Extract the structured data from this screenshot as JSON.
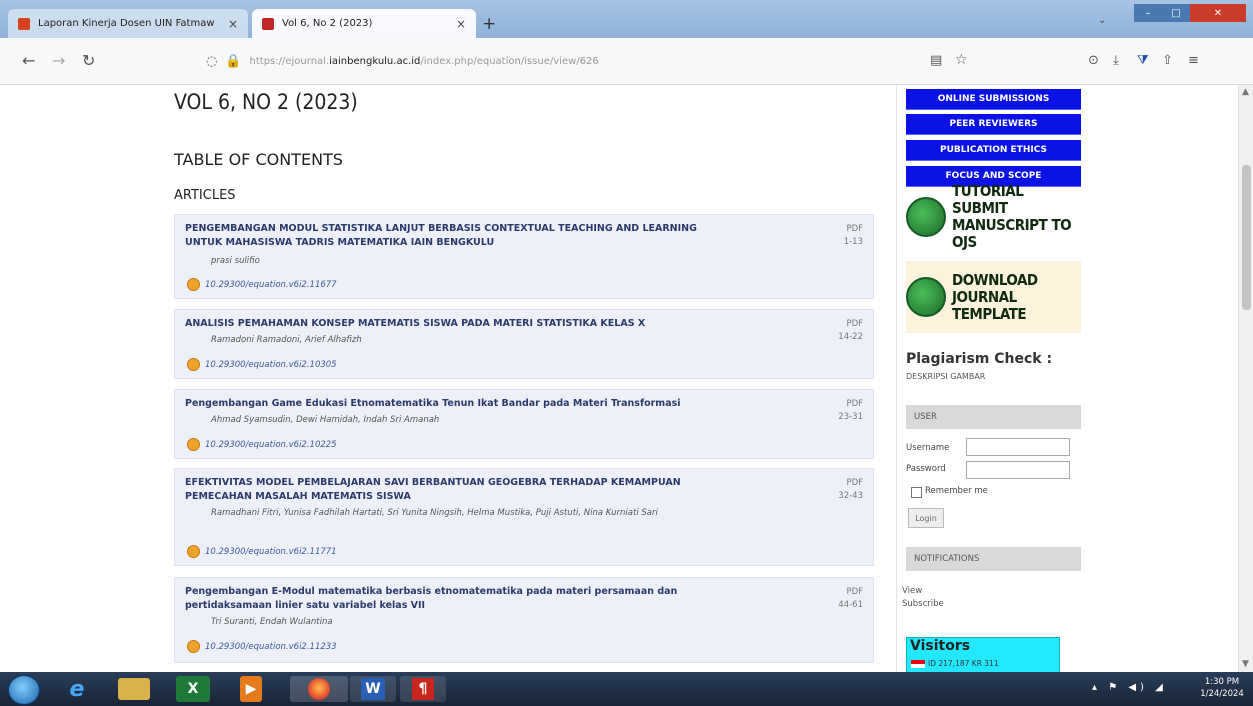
{
  "browser": {
    "tabs": [
      {
        "title": "Laporan Kinerja Dosen UIN Fatmaw",
        "active": false,
        "favicon_color": "#d9401d"
      },
      {
        "title": "Vol 6, No 2 (2023)",
        "active": true,
        "favicon_color": "#c2252a"
      }
    ],
    "new_tab_symbol": "+",
    "tab_close_symbol": "×",
    "url_prefix": "https://ejournal.",
    "url_domain": "iainbengkulu.ac.id",
    "url_path": "/index.php/equation/issue/view/626",
    "nav_icons": [
      "back-arrow-icon",
      "forward-arrow-icon",
      "reload-icon"
    ]
  },
  "issue": {
    "title": "VOL 6, NO 2 (2023)",
    "toc_heading": "TABLE OF CONTENTS",
    "section_heading": "ARTICLES"
  },
  "articles": [
    {
      "title": "PENGEMBANGAN MODUL STATISTIKA LANJUT BERBASIS CONTEXTUAL TEACHING AND LEARNING UNTUK MAHASISWA TADRIS MATEMATIKA IAIN BENGKULU",
      "authors": "prasi sulifio",
      "doi": "10.29300/equation.v6i2.11677",
      "format": "PDF",
      "pages": "1-13"
    },
    {
      "title": "ANALISIS PEMAHAMAN KONSEP MATEMATIS SISWA PADA MATERI STATISTIKA KELAS X",
      "authors": "Ramadoni Ramadoni, Arief Alhafizh",
      "doi": "10.29300/equation.v6i2.10305",
      "format": "PDF",
      "pages": "14-22"
    },
    {
      "title": "Pengembangan Game Edukasi Etnomatematika Tenun Ikat Bandar pada Materi Transformasi",
      "authors": "Ahmad Syamsudin, Dewi Hamidah, Indah Sri Amanah",
      "doi": "10.29300/equation.v6i2.10225",
      "format": "PDF",
      "pages": "23-31"
    },
    {
      "title": "EFEKTIVITAS MODEL PEMBELAJARAN SAVI BERBANTUAN GEOGEBRA TERHADAP KEMAMPUAN PEMECAHAN MASALAH MATEMATIS SISWA",
      "authors": "Ramadhani Fitri, Yunisa Fadhilah Hartati, Sri Yunita Ningsih, Helma Mustika, Puji Astuti, Nina Kurniati Sari",
      "doi": "10.29300/equation.v6i2.11771",
      "format": "PDF",
      "pages": "32-43"
    },
    {
      "title": "Pengembangan E-Modul matematika berbasis etnomatematika pada materi persamaan dan pertidaksamaan linier satu variabel kelas VII",
      "authors": "Tri Suranti, Endah Wulantina",
      "doi": "10.29300/equation.v6i2.11233",
      "format": "PDF",
      "pages": "44-61"
    }
  ],
  "sidebar": {
    "nav_buttons": [
      "ONLINE SUBMISSIONS",
      "PEER REVIEWERS",
      "PUBLICATION ETHICS",
      "FOCUS AND SCOPE"
    ],
    "nav_button_color": "#0a12e6",
    "tutorial_banner": "TUTORIAL SUBMIT MANUSCRIPT TO OJS",
    "template_banner": "DOWNLOAD JOURNAL TEMPLATE",
    "plagiarism_title": "Plagiarism Check :",
    "plagiarism_sub": "DESKRIPSI GAMBAR",
    "user_block": {
      "heading": "USER",
      "username_label": "Username",
      "password_label": "Password",
      "remember_label": "Remember me",
      "login_button": "Login"
    },
    "notifications": {
      "heading": "NOTIFICATIONS",
      "items": [
        "View",
        "Subscribe"
      ]
    },
    "visitors": {
      "title": "Visitors",
      "stats": "ID 217,187   KR 311"
    }
  },
  "taskbar": {
    "apps": [
      "internet-explorer-icon",
      "file-explorer-icon",
      "excel-icon",
      "media-player-icon",
      "firefox-icon",
      "word-icon",
      "pdf-reader-icon"
    ],
    "clock_time": "1:30 PM",
    "clock_date": "1/24/2024"
  }
}
